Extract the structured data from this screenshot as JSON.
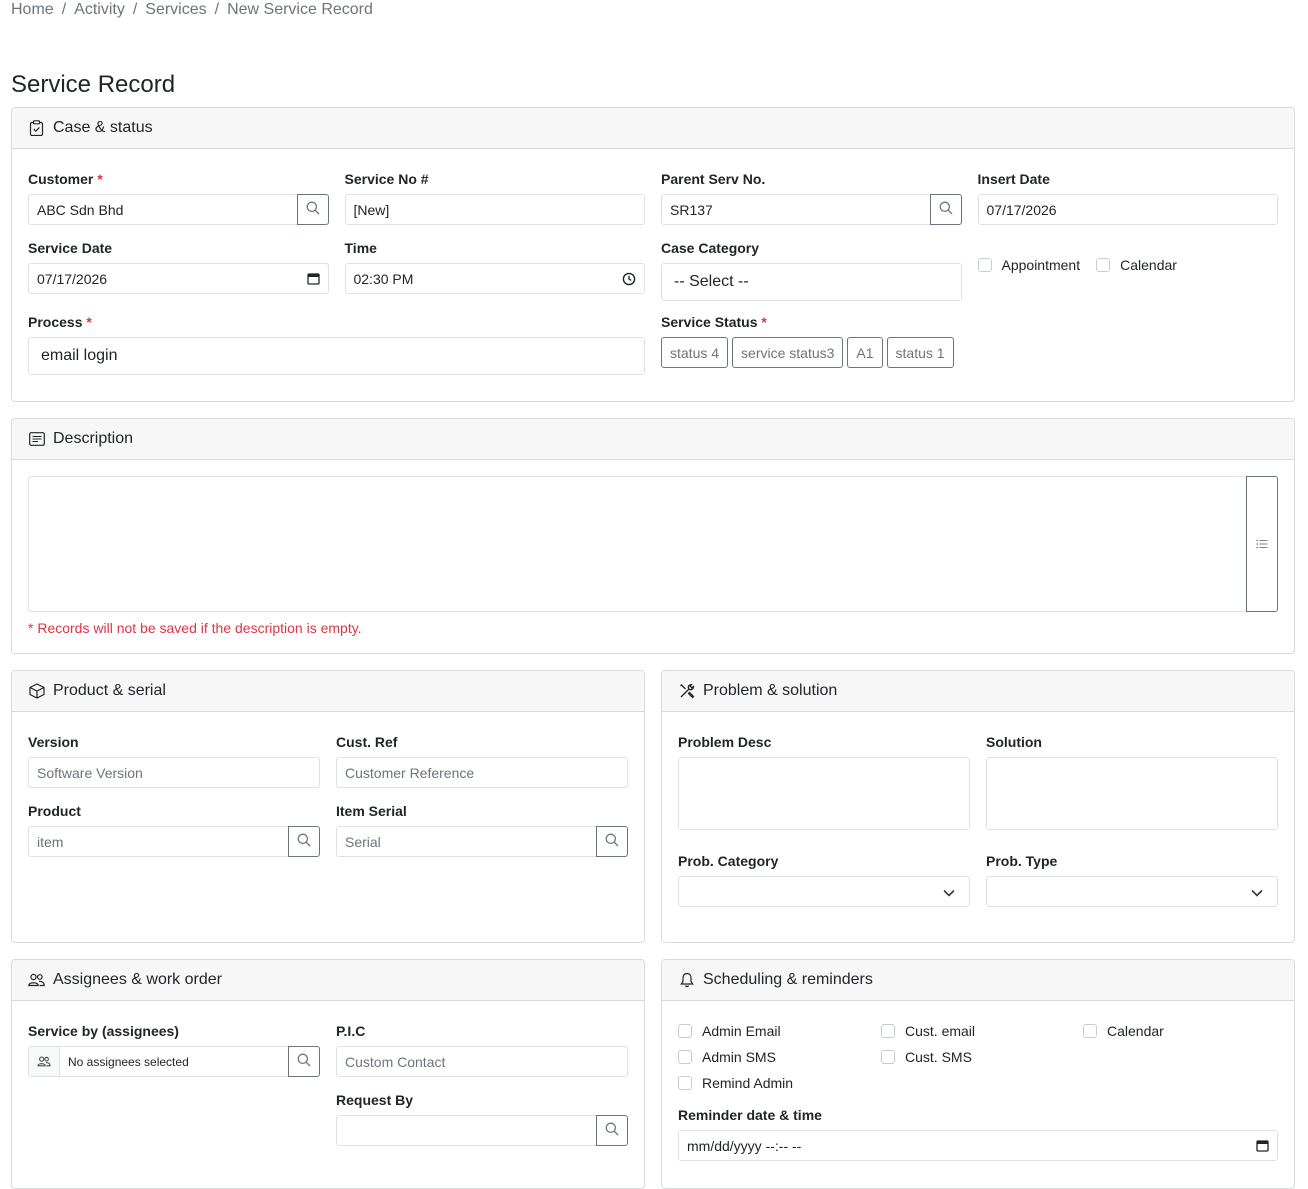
{
  "breadcrumb": [
    "Home",
    "Activity",
    "Services",
    "New Service Record"
  ],
  "page_title": "Service Record",
  "case": {
    "header": "Case & status",
    "customer_label": "Customer",
    "customer_value": "ABC Sdn Bhd",
    "service_no_label": "Service No #",
    "service_no_value": "[New]",
    "parent_label": "Parent Serv No.",
    "parent_value": "SR137",
    "insert_date_label": "Insert Date",
    "insert_date_value": "07/17/2026",
    "service_date_label": "Service Date",
    "service_date_value": "07/17/2026",
    "time_label": "Time",
    "time_value": "02:30 PM",
    "case_category_label": "Case Category",
    "case_category_value": "-- Select --",
    "appointment_label": "Appointment",
    "calendar_label": "Calendar",
    "process_label": "Process",
    "process_value": "email login",
    "service_status_label": "Service Status",
    "statuses": [
      "status 4",
      "service status3",
      "A1",
      "status 1"
    ],
    "required_mark": "*"
  },
  "description": {
    "header": "Description",
    "note": "* Records will not be saved if the description is empty."
  },
  "product": {
    "header": "Product & serial",
    "version_label": "Version",
    "version_placeholder": "Software Version",
    "custref_label": "Cust. Ref",
    "custref_placeholder": "Customer Reference",
    "product_label": "Product",
    "product_placeholder": "item",
    "serial_label": "Item Serial",
    "serial_placeholder": "Serial"
  },
  "problem": {
    "header": "Problem & solution",
    "desc_label": "Problem Desc",
    "solution_label": "Solution",
    "category_label": "Prob. Category",
    "type_label": "Prob. Type"
  },
  "assignees": {
    "header": "Assignees & work order",
    "service_by_label": "Service by (assignees)",
    "service_by_value": "No assignees selected",
    "pic_label": "P.I.C",
    "pic_placeholder": "Custom Contact",
    "request_by_label": "Request By"
  },
  "scheduling": {
    "header": "Scheduling & reminders",
    "admin_email": "Admin Email",
    "cust_email": "Cust. email",
    "calendar": "Calendar",
    "admin_sms": "Admin SMS",
    "cust_sms": "Cust. SMS",
    "remind_admin": "Remind Admin",
    "reminder_label": "Reminder date & time",
    "reminder_placeholder": "mm/dd/yyyy --:-- --"
  },
  "colors": {
    "required": "#dc3545",
    "border": "#dee2e6",
    "header_bg": "#f7f7f7",
    "muted": "#6c757d"
  }
}
